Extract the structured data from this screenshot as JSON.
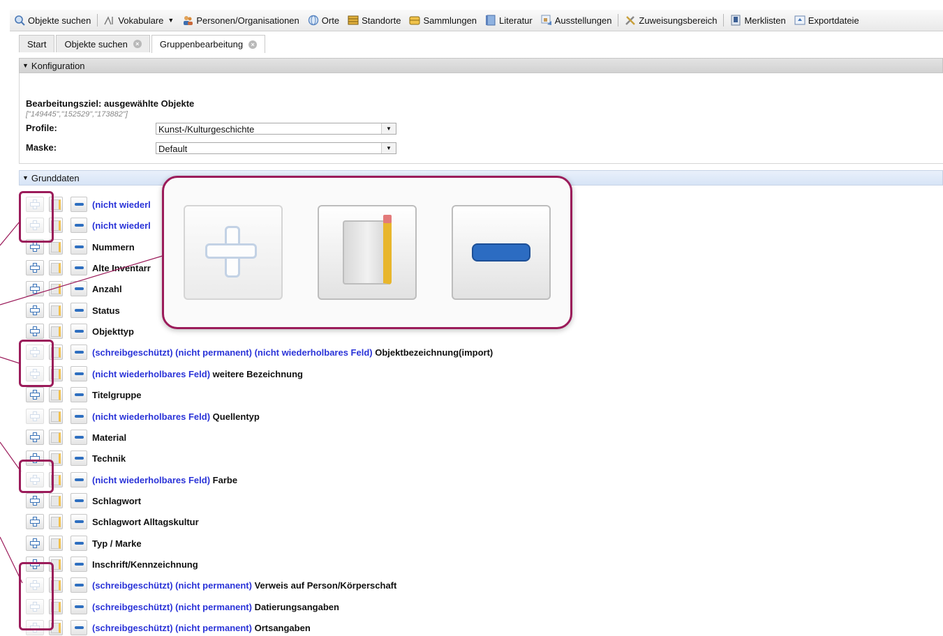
{
  "toolbar": {
    "items": [
      {
        "label": "Objekte suchen",
        "icon": "search-icon",
        "dropdown": false
      },
      {
        "label": "Vokabulare",
        "icon": "vocabulary-icon",
        "dropdown": true
      },
      {
        "label": "Personen/Organisationen",
        "icon": "people-icon",
        "dropdown": false
      },
      {
        "label": "Orte",
        "icon": "globe-icon",
        "dropdown": false
      },
      {
        "label": "Standorte",
        "icon": "locations-icon",
        "dropdown": false
      },
      {
        "label": "Sammlungen",
        "icon": "collections-icon",
        "dropdown": false
      },
      {
        "label": "Literatur",
        "icon": "book-icon",
        "dropdown": false
      },
      {
        "label": "Ausstellungen",
        "icon": "exhibition-icon",
        "dropdown": false
      },
      {
        "label": "Zuweisungsbereich",
        "icon": "tools-icon",
        "dropdown": false
      },
      {
        "label": "Merklisten",
        "icon": "bookmark-list-icon",
        "dropdown": false
      },
      {
        "label": "Exportdateie",
        "icon": "export-icon",
        "dropdown": false
      }
    ]
  },
  "tabs": [
    {
      "label": "Start",
      "closable": false,
      "active": false
    },
    {
      "label": "Objekte suchen",
      "closable": true,
      "active": false
    },
    {
      "label": "Gruppenbearbeitung",
      "closable": true,
      "active": true
    }
  ],
  "konfiguration": {
    "header": "Konfiguration",
    "target_label": "Bearbeitungsziel: ausgewählte Objekte",
    "target_ids": "[\"149445\",\"152529\",\"173882\"]",
    "profile_label": "Profile:",
    "profile_value": "Kunst-/Kulturgeschichte",
    "mask_label": "Maske:",
    "mask_value": "Default"
  },
  "grunddaten": {
    "header": "Grunddaten",
    "rows": [
      {
        "tags": "(nicht wiederl",
        "name": "",
        "add_disabled": true
      },
      {
        "tags": "(nicht wiederl",
        "name": "",
        "add_disabled": true
      },
      {
        "tags": "",
        "name": "Nummern",
        "add_disabled": false
      },
      {
        "tags": "",
        "name": "Alte Inventarr",
        "add_disabled": false
      },
      {
        "tags": "",
        "name": "Anzahl",
        "add_disabled": false
      },
      {
        "tags": "",
        "name": "Status",
        "add_disabled": false
      },
      {
        "tags": "",
        "name": "Objekttyp",
        "add_disabled": false
      },
      {
        "tags": "(schreibgeschützt) (nicht permanent) (nicht wiederholbares Feld)",
        "name": "Objektbezeichnung(import)",
        "add_disabled": true
      },
      {
        "tags": "(nicht wiederholbares Feld)",
        "name": "weitere Bezeichnung",
        "add_disabled": true
      },
      {
        "tags": "",
        "name": "Titelgruppe",
        "add_disabled": false
      },
      {
        "tags": "(nicht wiederholbares Feld)",
        "name": "Quellentyp",
        "add_disabled": true
      },
      {
        "tags": "",
        "name": "Material",
        "add_disabled": false
      },
      {
        "tags": "",
        "name": "Technik",
        "add_disabled": false
      },
      {
        "tags": "(nicht wiederholbares Feld)",
        "name": "Farbe",
        "add_disabled": true
      },
      {
        "tags": "",
        "name": "Schlagwort",
        "add_disabled": false
      },
      {
        "tags": "",
        "name": "Schlagwort Alltagskultur",
        "add_disabled": false
      },
      {
        "tags": "",
        "name": "Typ / Marke",
        "add_disabled": false
      },
      {
        "tags": "",
        "name": "Inschrift/Kennzeichnung",
        "add_disabled": false
      },
      {
        "tags": "(schreibgeschützt) (nicht permanent)",
        "name": "Verweis auf Person/Körperschaft",
        "add_disabled": true
      },
      {
        "tags": "(schreibgeschützt) (nicht permanent)",
        "name": "Datierungsangaben",
        "add_disabled": true
      },
      {
        "tags": "(schreibgeschützt) (nicht permanent)",
        "name": "Ortsangaben",
        "add_disabled": true
      }
    ]
  },
  "zoom_callout": {
    "buttons": [
      {
        "icon": "plus-icon",
        "state": "disabled"
      },
      {
        "icon": "notes-icon",
        "state": "enabled"
      },
      {
        "icon": "minus-icon",
        "state": "enabled"
      }
    ]
  },
  "colors": {
    "highlight": "#9b1b5a",
    "tag_text": "#2b34d8",
    "plus_blue": "#3a73b8",
    "minus_blue": "#2e6fc0"
  }
}
